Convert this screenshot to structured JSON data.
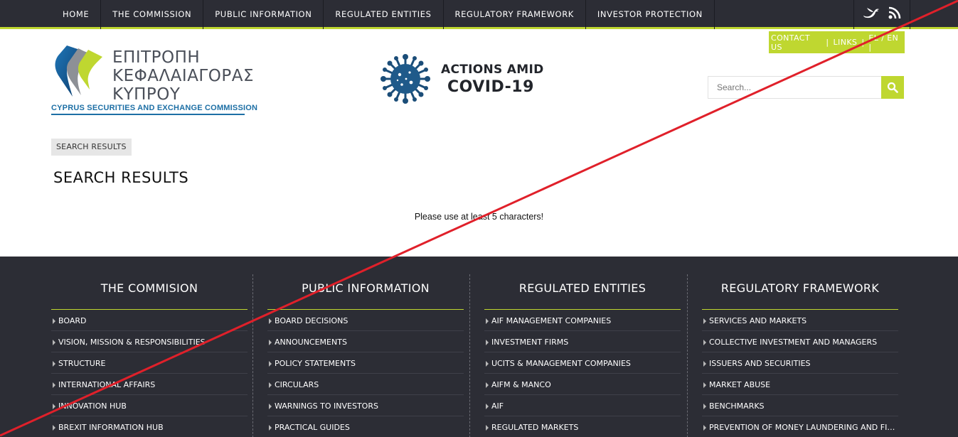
{
  "nav": {
    "items": [
      "HOME",
      "THE COMMISSION",
      "PUBLIC INFORMATION",
      "REGULATED ENTITIES",
      "REGULATORY FRAMEWORK",
      "INVESTOR PROTECTION"
    ],
    "social_icons": [
      "twitter-bird-icon",
      "rss-icon"
    ]
  },
  "contact": {
    "contact_us": "CONTACT US",
    "links": "LINKS",
    "sep": "|",
    "lang": "EL / EN |"
  },
  "logo": {
    "line1": "ΕΠΙΤΡΟΠΗ",
    "line2": "ΚΕΦΑΛΑΙΑΓΟΡΑΣ",
    "line3": "ΚΥΠΡΟΥ",
    "subtitle": "CYPRUS SECURITIES AND EXCHANGE COMMISSION"
  },
  "covid": {
    "line1": "ACTIONS AMID",
    "line2": "COVID-19"
  },
  "search": {
    "placeholder": "Search..."
  },
  "breadcrumb": "SEARCH RESULTS",
  "page_title": "SEARCH RESULTS",
  "message": "Please use at least 5 characters!",
  "colors": {
    "accent": "#bfd730",
    "dark": "#2c2d35",
    "logo_blue": "#1d6fa5",
    "overlay_red": "#e0202a"
  },
  "footer": {
    "columns": [
      {
        "title": "THE COMMISION",
        "items": [
          "BOARD",
          "VISION, MISSION & RESPONSIBILITIES",
          "STRUCTURE",
          "INTERNATIONAL AFFAIRS",
          "INNOVATION HUB",
          "BREXIT INFORMATION HUB"
        ]
      },
      {
        "title": "PUBLIC INFORMATION",
        "items": [
          "BOARD DECISIONS",
          "ANNOUNCEMENTS",
          "POLICY STATEMENTS",
          "CIRCULARS",
          "WARNINGS TO INVESTORS",
          "PRACTICAL GUIDES"
        ]
      },
      {
        "title": "REGULATED ENTITIES",
        "items": [
          "AIF MANAGEMENT COMPANIES",
          "INVESTMENT FIRMS",
          "UCITS & MANAGEMENT COMPANIES",
          "AIFM & MANCO",
          "AIF",
          "REGULATED MARKETS"
        ]
      },
      {
        "title": "REGULATORY FRAMEWORK",
        "items": [
          "SERVICES AND MARKETS",
          "COLLECTIVE INVESTMENT AND MANAGERS",
          "ISSUERS AND SECURITIES",
          "MARKET ABUSE",
          "BENCHMARKS",
          "PREVENTION OF MONEY LAUNDERING AND FINANCI..."
        ]
      }
    ]
  }
}
